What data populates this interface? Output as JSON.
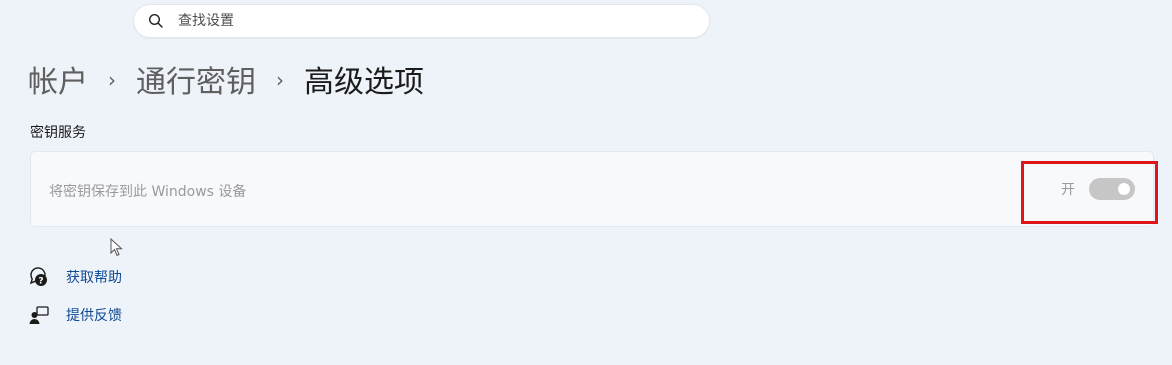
{
  "search": {
    "placeholder": "查找设置"
  },
  "breadcrumb": [
    {
      "label": "帐户"
    },
    {
      "label": "通行密钥"
    },
    {
      "label": "高级选项"
    }
  ],
  "section": {
    "title": "密钥服务",
    "setting": {
      "label": "将密钥保存到此 Windows 设备",
      "toggle_state": "开"
    }
  },
  "links": [
    {
      "label": "获取帮助",
      "icon": "help-chat-icon"
    },
    {
      "label": "提供反馈",
      "icon": "feedback-icon"
    }
  ],
  "colors": {
    "accent_link": "#0f4a94",
    "highlight_box": "#e0141b",
    "background": "#eef2f9"
  }
}
